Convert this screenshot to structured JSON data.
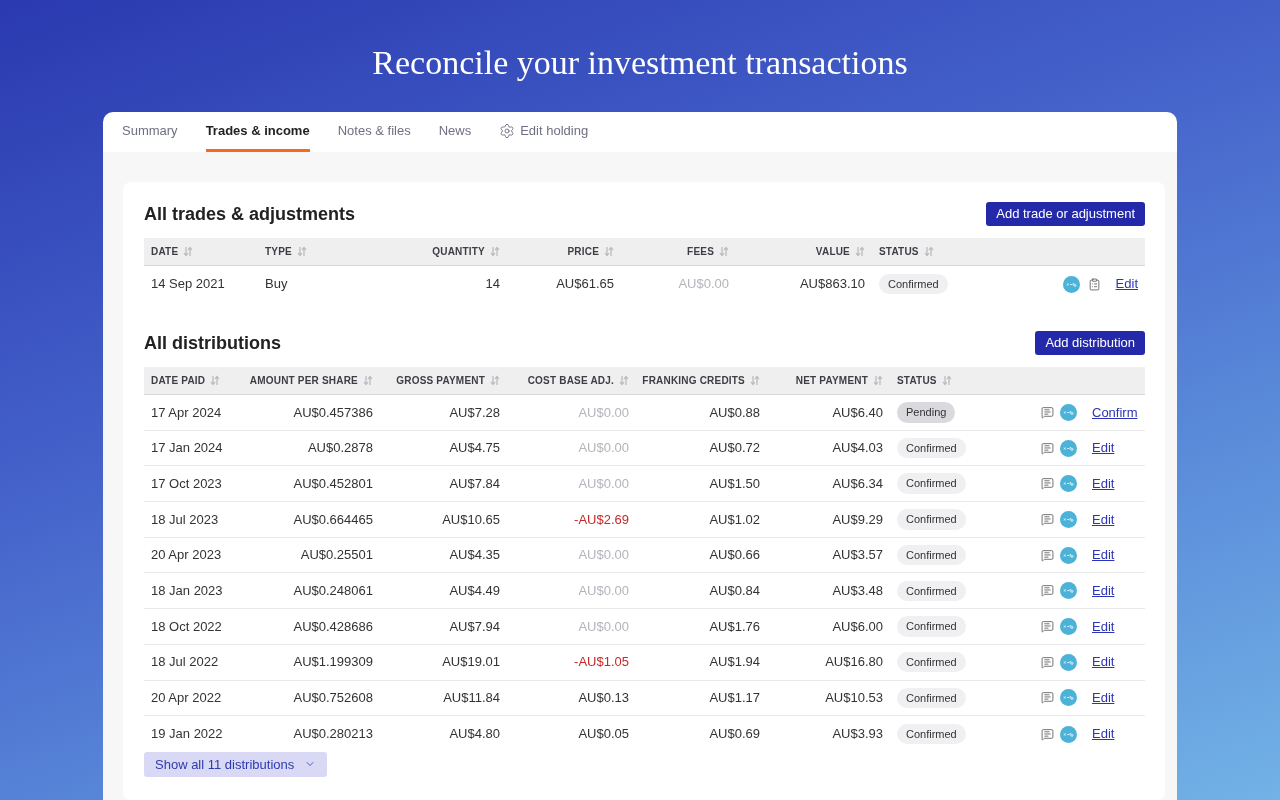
{
  "page_title": "Reconcile your investment transactions",
  "tabs": [
    {
      "label": "Summary",
      "selected": false,
      "kind": "plain"
    },
    {
      "label": "Trades & income",
      "selected": true,
      "kind": "plain"
    },
    {
      "label": "Notes & files",
      "selected": false,
      "kind": "plain"
    },
    {
      "label": "News",
      "selected": false,
      "kind": "plain"
    },
    {
      "label": "Edit holding",
      "selected": false,
      "kind": "settings"
    }
  ],
  "trades": {
    "title": "All trades & adjustments",
    "add_button": "Add trade or adjustment",
    "columns": [
      "DATE",
      "TYPE",
      "QUANTITY",
      "PRICE",
      "FEES",
      "VALUE",
      "STATUS"
    ],
    "rows": [
      {
        "date": "14 Sep 2021",
        "type": "Buy",
        "quantity": "14",
        "price": "AU$61.65",
        "fees": {
          "text": "AU$0.00",
          "kind": "muted"
        },
        "value": "AU$863.10",
        "status": {
          "label": "Confirmed",
          "kind": "confirmed"
        },
        "action": "Edit"
      }
    ]
  },
  "distributions": {
    "title": "All distributions",
    "add_button": "Add distribution",
    "columns": [
      "DATE PAID",
      "AMOUNT PER SHARE",
      "GROSS PAYMENT",
      "COST BASE ADJ.",
      "FRANKING CREDITS",
      "NET PAYMENT",
      "STATUS"
    ],
    "rows": [
      {
        "date_paid": "17 Apr 2024",
        "amount_per_share": "AU$0.457386",
        "gross_payment": "AU$7.28",
        "cost_base_adj": {
          "text": "AU$0.00",
          "kind": "muted"
        },
        "franking_credits": "AU$0.88",
        "net_payment": "AU$6.40",
        "status": {
          "label": "Pending",
          "kind": "pending"
        },
        "action": "Confirm"
      },
      {
        "date_paid": "17 Jan 2024",
        "amount_per_share": "AU$0.2878",
        "gross_payment": "AU$4.75",
        "cost_base_adj": {
          "text": "AU$0.00",
          "kind": "muted"
        },
        "franking_credits": "AU$0.72",
        "net_payment": "AU$4.03",
        "status": {
          "label": "Confirmed",
          "kind": "confirmed"
        },
        "action": "Edit"
      },
      {
        "date_paid": "17 Oct 2023",
        "amount_per_share": "AU$0.452801",
        "gross_payment": "AU$7.84",
        "cost_base_adj": {
          "text": "AU$0.00",
          "kind": "muted"
        },
        "franking_credits": "AU$1.50",
        "net_payment": "AU$6.34",
        "status": {
          "label": "Confirmed",
          "kind": "confirmed"
        },
        "action": "Edit"
      },
      {
        "date_paid": "18 Jul 2023",
        "amount_per_share": "AU$0.664465",
        "gross_payment": "AU$10.65",
        "cost_base_adj": {
          "text": "-AU$2.69",
          "kind": "negative"
        },
        "franking_credits": "AU$1.02",
        "net_payment": "AU$9.29",
        "status": {
          "label": "Confirmed",
          "kind": "confirmed"
        },
        "action": "Edit"
      },
      {
        "date_paid": "20 Apr 2023",
        "amount_per_share": "AU$0.25501",
        "gross_payment": "AU$4.35",
        "cost_base_adj": {
          "text": "AU$0.00",
          "kind": "muted"
        },
        "franking_credits": "AU$0.66",
        "net_payment": "AU$3.57",
        "status": {
          "label": "Confirmed",
          "kind": "confirmed"
        },
        "action": "Edit"
      },
      {
        "date_paid": "18 Jan 2023",
        "amount_per_share": "AU$0.248061",
        "gross_payment": "AU$4.49",
        "cost_base_adj": {
          "text": "AU$0.00",
          "kind": "muted"
        },
        "franking_credits": "AU$0.84",
        "net_payment": "AU$3.48",
        "status": {
          "label": "Confirmed",
          "kind": "confirmed"
        },
        "action": "Edit"
      },
      {
        "date_paid": "18 Oct 2022",
        "amount_per_share": "AU$0.428686",
        "gross_payment": "AU$7.94",
        "cost_base_adj": {
          "text": "AU$0.00",
          "kind": "muted"
        },
        "franking_credits": "AU$1.76",
        "net_payment": "AU$6.00",
        "status": {
          "label": "Confirmed",
          "kind": "confirmed"
        },
        "action": "Edit"
      },
      {
        "date_paid": "18 Jul 2022",
        "amount_per_share": "AU$1.199309",
        "gross_payment": "AU$19.01",
        "cost_base_adj": {
          "text": "-AU$1.05",
          "kind": "negative"
        },
        "franking_credits": "AU$1.94",
        "net_payment": "AU$16.80",
        "status": {
          "label": "Confirmed",
          "kind": "confirmed"
        },
        "action": "Edit"
      },
      {
        "date_paid": "20 Apr 2022",
        "amount_per_share": "AU$0.752608",
        "gross_payment": "AU$11.84",
        "cost_base_adj": {
          "text": "AU$0.13",
          "kind": "plain"
        },
        "franking_credits": "AU$1.17",
        "net_payment": "AU$10.53",
        "status": {
          "label": "Confirmed",
          "kind": "confirmed"
        },
        "action": "Edit"
      },
      {
        "date_paid": "19 Jan 2022",
        "amount_per_share": "AU$0.280213",
        "gross_payment": "AU$4.80",
        "cost_base_adj": {
          "text": "AU$0.05",
          "kind": "plain"
        },
        "franking_credits": "AU$0.69",
        "net_payment": "AU$3.93",
        "status": {
          "label": "Confirmed",
          "kind": "confirmed"
        },
        "action": "Edit"
      }
    ],
    "show_all": "Show all 11 distributions"
  }
}
